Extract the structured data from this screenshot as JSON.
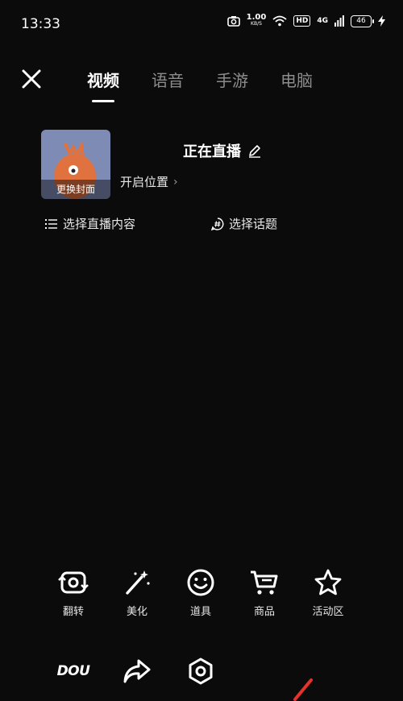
{
  "status_bar": {
    "time": "13:33",
    "net_speed_value": "1.00",
    "net_speed_unit": "KB/S",
    "hd_badge": "HD",
    "network_type": "4G",
    "battery": "46"
  },
  "tabs": [
    {
      "label": "视频",
      "active": true
    },
    {
      "label": "语音",
      "active": false
    },
    {
      "label": "手游",
      "active": false
    },
    {
      "label": "电脑",
      "active": false
    }
  ],
  "live": {
    "cover_label": "更换封面",
    "title": "正在直播",
    "location_label": "开启位置",
    "choose_content": "选择直播内容",
    "choose_topic": "选择话题"
  },
  "tools": {
    "flip": "翻转",
    "beautify": "美化",
    "props": "道具",
    "goods": "商品",
    "activity": "活动区",
    "dou_logo": "DOU",
    "share": "",
    "settings": ""
  },
  "colors": {
    "background": "#0b0b0b",
    "inactive_tab": "#8c8c8c",
    "cover_bg": "#7e8bb4",
    "mascot": "#e0723f",
    "accent_red": "#e5322d"
  }
}
